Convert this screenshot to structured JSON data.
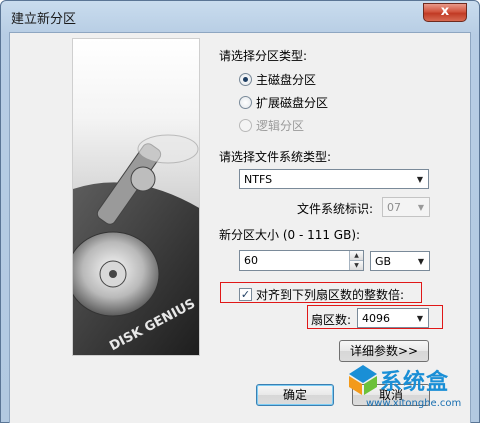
{
  "window": {
    "title": "建立新分区",
    "close_label": "x"
  },
  "partition_type": {
    "label": "请选择分区类型:",
    "options": [
      {
        "label": "主磁盘分区",
        "checked": true,
        "disabled": false
      },
      {
        "label": "扩展磁盘分区",
        "checked": false,
        "disabled": false
      },
      {
        "label": "逻辑分区",
        "checked": false,
        "disabled": true
      }
    ]
  },
  "filesystem": {
    "label": "请选择文件系统类型:",
    "selected": "NTFS",
    "id_label": "文件系统标识:",
    "id_value": "07"
  },
  "size": {
    "label": "新分区大小 (0 - 111 GB):",
    "value": "60",
    "unit": "GB"
  },
  "align": {
    "label": "对齐到下列扇区数的整数倍:",
    "checked": true,
    "sector_label": "扇区数:",
    "sector_value": "4096"
  },
  "buttons": {
    "details": "详细参数>>",
    "ok": "确定",
    "cancel": "取消"
  },
  "image": {
    "brand_text": "DISK GENIUS"
  },
  "watermark": {
    "text": "系统盒",
    "url": "www.xitonghe.com"
  }
}
